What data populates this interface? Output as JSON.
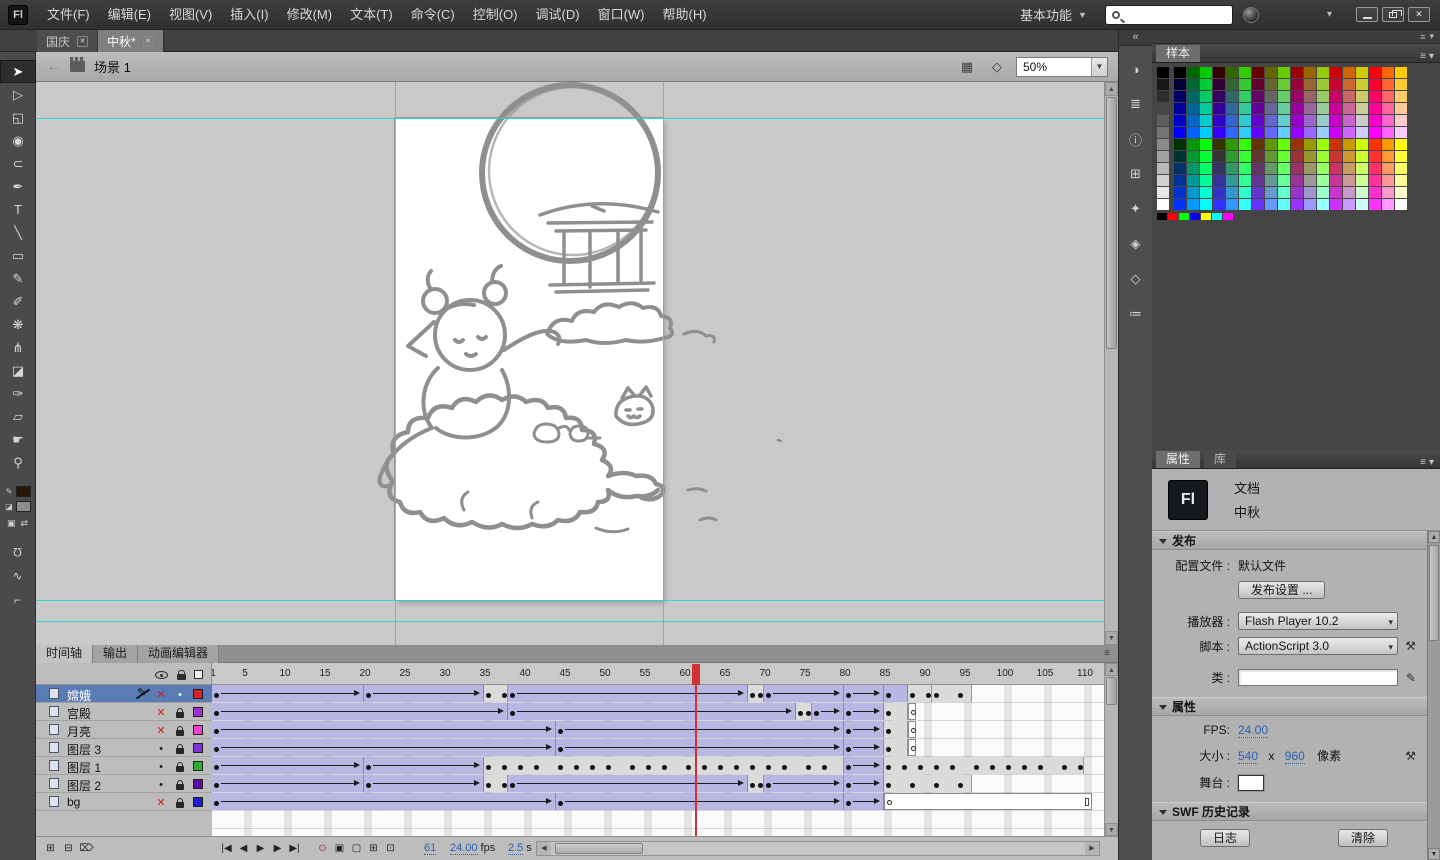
{
  "menubar": {
    "logo": "Fl",
    "items": [
      "文件(F)",
      "编辑(E)",
      "视图(V)",
      "插入(I)",
      "修改(M)",
      "文本(T)",
      "命令(C)",
      "控制(O)",
      "调试(D)",
      "窗口(W)",
      "帮助(H)"
    ],
    "workspace": "基本功能"
  },
  "doc_tabs": [
    {
      "label": "国庆",
      "active": false
    },
    {
      "label": "中秋*",
      "active": true
    }
  ],
  "edit_bar": {
    "scene": "场景 1",
    "zoom": "50%"
  },
  "tools": [
    {
      "name": "selection-tool",
      "glyph": "➤",
      "selected": true
    },
    {
      "name": "subselection-tool",
      "glyph": "▷",
      "selected": false
    },
    {
      "name": "free-transform-tool",
      "glyph": "◱",
      "selected": false
    },
    {
      "name": "3d-rotation-tool",
      "glyph": "◉",
      "selected": false
    },
    {
      "name": "lasso-tool",
      "glyph": "⊂",
      "selected": false
    },
    {
      "name": "pen-tool",
      "glyph": "✒",
      "selected": false
    },
    {
      "name": "text-tool",
      "glyph": "T",
      "selected": false
    },
    {
      "name": "line-tool",
      "glyph": "╲",
      "selected": false
    },
    {
      "name": "rectangle-tool",
      "glyph": "▭",
      "selected": false
    },
    {
      "name": "pencil-tool",
      "glyph": "✎",
      "selected": false
    },
    {
      "name": "brush-tool",
      "glyph": "✐",
      "selected": false
    },
    {
      "name": "deco-tool",
      "glyph": "❋",
      "selected": false
    },
    {
      "name": "bone-tool",
      "glyph": "⋔",
      "selected": false
    },
    {
      "name": "paint-bucket-tool",
      "glyph": "◪",
      "selected": false
    },
    {
      "name": "eyedropper-tool",
      "glyph": "✑",
      "selected": false
    },
    {
      "name": "eraser-tool",
      "glyph": "▱",
      "selected": false
    },
    {
      "name": "hand-tool",
      "glyph": "☛",
      "selected": false
    },
    {
      "name": "zoom-tool",
      "glyph": "⚲",
      "selected": false
    }
  ],
  "tool_colors": {
    "stroke": "#2a1506",
    "fill": "#8c8c8c"
  },
  "tool_mini": [
    {
      "name": "default-colors-button",
      "glyph": "▣"
    },
    {
      "name": "swap-colors-button",
      "glyph": "⇄"
    }
  ],
  "tool_options": [
    {
      "name": "snap-to-objects-button",
      "glyph": "Ω",
      "flip": true
    },
    {
      "name": "smooth-button",
      "glyph": "∿",
      "flip": false
    },
    {
      "name": "straighten-button",
      "glyph": "⌐",
      "flip": false
    }
  ],
  "panel_strip": [
    {
      "name": "color-panel-icon",
      "glyph": "◑"
    },
    {
      "name": "align-panel-icon",
      "glyph": "≣"
    },
    {
      "name": "info-panel-icon",
      "glyph": "ⓘ"
    },
    {
      "name": "transform-panel-icon",
      "glyph": "⊞"
    },
    {
      "name": "code-snippets-panel-icon",
      "glyph": "✦"
    },
    {
      "name": "components-panel-icon",
      "glyph": "◈"
    },
    {
      "name": "motion-presets-panel-icon",
      "glyph": "◇"
    },
    {
      "name": "library-panel-icon",
      "glyph": "≔"
    }
  ],
  "swatches_panel": {
    "title": "样本",
    "palette": "web-safe-216",
    "gray_steps": 12,
    "bottom_row": [
      "#000000",
      "#FF0000",
      "#00FF00",
      "#0000FF",
      "#FFFF00",
      "#00FFFF",
      "#FF00FF"
    ]
  },
  "properties_panel": {
    "tabs": [
      {
        "label": "属性",
        "active": true
      },
      {
        "label": "库",
        "active": false
      }
    ],
    "doc_icon": "Fl",
    "doc_type": "文档",
    "doc_name": "中秋",
    "publish": {
      "title": "发布",
      "profile_label": "配置文件 :",
      "profile_value": "默认文件",
      "publish_settings_button": "发布设置 ...",
      "player_label": "播放器 :",
      "player_value": "Flash Player 10.2",
      "script_label": "脚本 :",
      "script_value": "ActionScript 3.0",
      "class_label": "类 :",
      "class_value": ""
    },
    "props": {
      "title": "属性",
      "fps_label": "FPS:",
      "fps_value": "24.00",
      "size_label": "大小 :",
      "size_width": "540",
      "size_sep": "x",
      "size_height": "960",
      "size_unit": "像素",
      "stage_label": "舞台 :",
      "stage_color": "#ffffff"
    },
    "history": {
      "title": "SWF 历史记录",
      "log_button": "日志",
      "clear_button": "清除"
    }
  },
  "timeline": {
    "tabs": [
      {
        "label": "时间轴",
        "active": true
      },
      {
        "label": "输出",
        "active": false
      },
      {
        "label": "动画编辑器",
        "active": false
      }
    ],
    "frame_width": 8,
    "ruler_max": 110,
    "playhead_frame": 61,
    "layers": [
      {
        "name": "嫦娥",
        "color": "#d32222",
        "hidden": true,
        "locked": false,
        "selected": true,
        "segments": [
          {
            "t": "tween",
            "s": 1,
            "e": 19
          },
          {
            "t": "tween",
            "s": 20,
            "e": 34
          },
          {
            "t": "keys",
            "s": 35,
            "e": 37,
            "dots": [
              35,
              37
            ]
          },
          {
            "t": "tween",
            "s": 38,
            "e": 67
          },
          {
            "t": "keys",
            "s": 68,
            "e": 69,
            "dots": [
              68,
              69
            ]
          },
          {
            "t": "tween",
            "s": 70,
            "e": 79
          },
          {
            "t": "tween",
            "s": 80,
            "e": 84
          },
          {
            "t": "tween",
            "s": 85,
            "e": 87
          },
          {
            "t": "keys",
            "s": 88,
            "e": 90,
            "dots": [
              88,
              90
            ]
          },
          {
            "t": "keys",
            "s": 91,
            "e": 95,
            "dots": [
              91,
              94
            ]
          }
        ]
      },
      {
        "name": "宫殿",
        "color": "#9a36cf",
        "hidden": true,
        "locked": true,
        "selected": false,
        "segments": [
          {
            "t": "tween",
            "s": 1,
            "e": 37
          },
          {
            "t": "tween",
            "s": 38,
            "e": 73
          },
          {
            "t": "keys",
            "s": 74,
            "e": 75,
            "dots": [
              74,
              75
            ]
          },
          {
            "t": "tween",
            "s": 76,
            "e": 79
          },
          {
            "t": "tween",
            "s": 80,
            "e": 84
          },
          {
            "t": "keys",
            "s": 85,
            "e": 87,
            "dots": [
              85
            ]
          },
          {
            "t": "blank",
            "s": 88,
            "e": 88
          }
        ]
      },
      {
        "name": "月亮",
        "color": "#ef3fd0",
        "hidden": true,
        "locked": true,
        "selected": false,
        "segments": [
          {
            "t": "tween",
            "s": 1,
            "e": 43
          },
          {
            "t": "tween",
            "s": 44,
            "e": 79
          },
          {
            "t": "tween",
            "s": 80,
            "e": 84
          },
          {
            "t": "keys",
            "s": 85,
            "e": 87,
            "dots": [
              85
            ]
          },
          {
            "t": "blank",
            "s": 88,
            "e": 88
          }
        ]
      },
      {
        "name": "图层 3",
        "color": "#7e34d2",
        "hidden": false,
        "locked": true,
        "selected": false,
        "segments": [
          {
            "t": "tween",
            "s": 1,
            "e": 43
          },
          {
            "t": "tween",
            "s": 44,
            "e": 79
          },
          {
            "t": "tween",
            "s": 80,
            "e": 84
          },
          {
            "t": "keys",
            "s": 85,
            "e": 87,
            "dots": [
              85
            ]
          },
          {
            "t": "blank",
            "s": 88,
            "e": 88
          }
        ]
      },
      {
        "name": "图层 1",
        "color": "#2fae2f",
        "hidden": false,
        "locked": true,
        "selected": false,
        "segments": [
          {
            "t": "tween",
            "s": 1,
            "e": 19
          },
          {
            "t": "tween",
            "s": 20,
            "e": 34
          },
          {
            "t": "keys",
            "s": 35,
            "e": 79,
            "dots": [
              35,
              37,
              39,
              41,
              44,
              46,
              48,
              50,
              53,
              55,
              57,
              60,
              62,
              64,
              66,
              68,
              70,
              72,
              75,
              77
            ]
          },
          {
            "t": "tween",
            "s": 80,
            "e": 84
          },
          {
            "t": "keys",
            "s": 85,
            "e": 109,
            "dots": [
              85,
              87,
              89,
              91,
              93,
              96,
              98,
              100,
              102,
              104,
              107,
              109
            ]
          }
        ]
      },
      {
        "name": "图层 2",
        "color": "#5c0fa0",
        "hidden": false,
        "locked": true,
        "selected": false,
        "segments": [
          {
            "t": "tween",
            "s": 1,
            "e": 19
          },
          {
            "t": "tween",
            "s": 20,
            "e": 34
          },
          {
            "t": "keys",
            "s": 35,
            "e": 37,
            "dots": [
              35,
              37
            ]
          },
          {
            "t": "tween",
            "s": 38,
            "e": 67
          },
          {
            "t": "keys",
            "s": 68,
            "e": 69,
            "dots": [
              68,
              69
            ]
          },
          {
            "t": "tween",
            "s": 70,
            "e": 79
          },
          {
            "t": "tween",
            "s": 80,
            "e": 84
          },
          {
            "t": "keys",
            "s": 85,
            "e": 95,
            "dots": [
              85,
              88,
              91,
              94
            ]
          }
        ]
      },
      {
        "name": "bg",
        "color": "#1f1fd0",
        "hidden": true,
        "locked": true,
        "selected": false,
        "segments": [
          {
            "t": "tween",
            "s": 1,
            "e": 43
          },
          {
            "t": "tween",
            "s": 44,
            "e": 79
          },
          {
            "t": "tween",
            "s": 80,
            "e": 84
          },
          {
            "t": "blank",
            "s": 85,
            "e": 110
          }
        ]
      }
    ],
    "controls": {
      "layer_buttons": [
        {
          "name": "new-layer-button",
          "glyph": "⊞"
        },
        {
          "name": "new-folder-button",
          "glyph": "⊟"
        },
        {
          "name": "delete-layer-button",
          "glyph": "⌦"
        }
      ],
      "playback_buttons": [
        {
          "name": "first-frame-button",
          "glyph": "|◀"
        },
        {
          "name": "prev-frame-button",
          "glyph": "◀"
        },
        {
          "name": "play-button",
          "glyph": "▶"
        },
        {
          "name": "next-frame-button",
          "glyph": "▶"
        },
        {
          "name": "last-frame-button",
          "glyph": "▶|"
        }
      ],
      "onion_buttons": [
        {
          "name": "center-frame-button",
          "glyph": "⊙",
          "accent": true
        },
        {
          "name": "onion-skin-button",
          "glyph": "▣",
          "accent": false
        },
        {
          "name": "onion-skin-outlines-button",
          "glyph": "▢",
          "accent": false
        },
        {
          "name": "edit-multiple-frames-button",
          "glyph": "⊞",
          "accent": false
        },
        {
          "name": "modify-markers-button",
          "glyph": "⊡",
          "accent": false
        }
      ]
    },
    "status": {
      "current_frame": "61",
      "fps_value": "24.00",
      "fps_unit": "fps",
      "elapsed": "2.5",
      "elapsed_unit": "s"
    }
  }
}
